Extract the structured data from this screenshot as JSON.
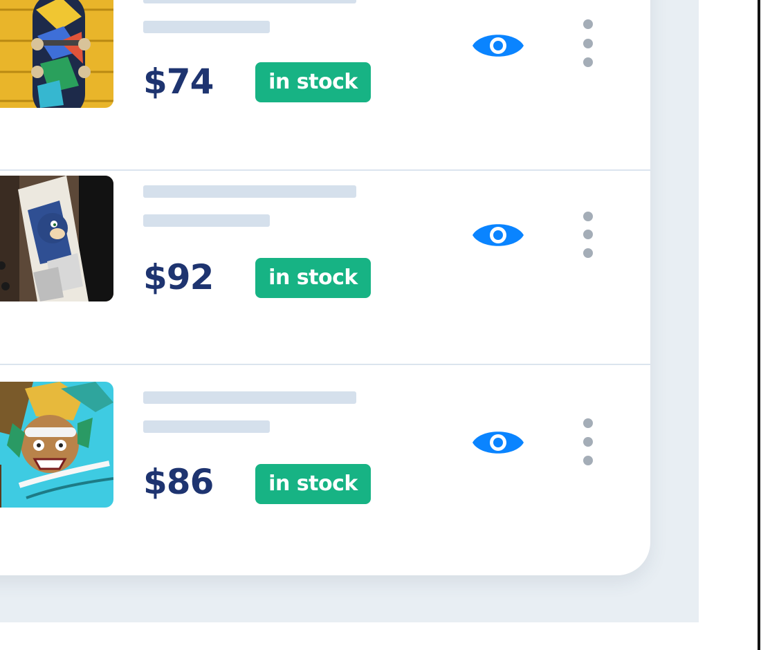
{
  "products": [
    {
      "image": "skateboard-deck-colorful-graffiti",
      "price": "$74",
      "status": "in stock"
    },
    {
      "image": "skateboard-deck-sonic",
      "price": "$92",
      "status": "in stock"
    },
    {
      "image": "skateboard-deck-rocket-warrior",
      "price": "$86",
      "status": "in stock"
    }
  ],
  "icons": {
    "view": "eye-icon",
    "more": "more-vertical-icon"
  },
  "colors": {
    "price": "#1e3470",
    "badge": "#17b384",
    "eye": "#0a84ff",
    "placeholder": "#d5e0ec",
    "background": "#e8eef3"
  }
}
